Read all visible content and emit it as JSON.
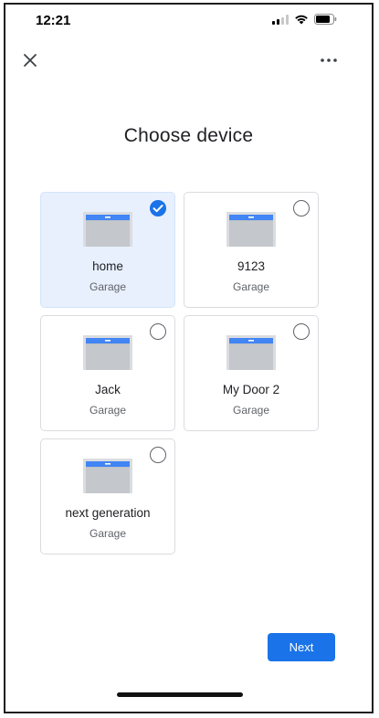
{
  "status_bar": {
    "time": "12:21"
  },
  "page_title": "Choose device",
  "devices": [
    {
      "name": "home",
      "type": "Garage",
      "selected": true
    },
    {
      "name": "9123",
      "type": "Garage",
      "selected": false
    },
    {
      "name": "Jack",
      "type": "Garage",
      "selected": false
    },
    {
      "name": "My Door 2",
      "type": "Garage",
      "selected": false
    },
    {
      "name": "next generation",
      "type": "Garage",
      "selected": false
    }
  ],
  "next_label": "Next",
  "colors": {
    "accent": "#1a73e8",
    "selected_card": "#e8f0fe"
  },
  "icons": {
    "close": "close-icon",
    "more": "more-horizontal-icon",
    "device": "garage-door-icon",
    "check": "check-icon"
  }
}
